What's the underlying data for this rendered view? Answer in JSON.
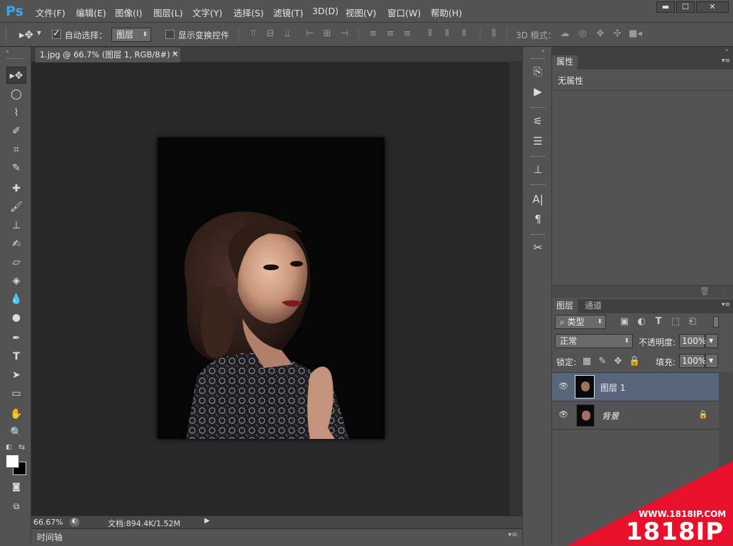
{
  "app": {
    "logo": "Ps"
  },
  "menu": [
    "文件(F)",
    "编辑(E)",
    "图像(I)",
    "图层(L)",
    "文字(Y)",
    "选择(S)",
    "滤镜(T)",
    "3D(D)",
    "视图(V)",
    "窗口(W)",
    "帮助(H)"
  ],
  "window_controls": {
    "minimize": "▬",
    "maximize": "☐",
    "close": "✕"
  },
  "options": {
    "auto_select_label": "自动选择：",
    "auto_select_checked": true,
    "auto_select_target": "图层",
    "show_transform_label": "显示变换控件",
    "show_transform_checked": false,
    "mode_3d_label": "3D 模式："
  },
  "document": {
    "tab_title": "1.jpg @ 66.7% (图层 1, RGB/8#) *",
    "tab_close": "×"
  },
  "status": {
    "zoom": "66.67%",
    "doc_info": "文档:894.4K/1.52M"
  },
  "timeline": {
    "label": "时间轴"
  },
  "properties": {
    "tab": "属性",
    "content": "无属性"
  },
  "layers_panel": {
    "tabs": [
      "图层",
      "通道"
    ],
    "filter_kind": "类型",
    "blend_mode": "正常",
    "opacity_label": "不透明度:",
    "opacity_value": "100%",
    "lock_label": "锁定:",
    "fill_label": "填充:",
    "fill_value": "100%",
    "layers": [
      {
        "name": "图层 1",
        "visible": true,
        "selected": true,
        "locked": false
      },
      {
        "name": "背景",
        "visible": true,
        "selected": false,
        "locked": true
      }
    ]
  },
  "watermark": {
    "url": "WWW.1818IP.COM",
    "brand": "1818IP"
  },
  "colors": {
    "accent_blue": "#37a7f2",
    "panel_bg": "#535353",
    "canvas_bg": "#282828",
    "selected_layer": "#59657a",
    "watermark_red": "#e8102a"
  }
}
